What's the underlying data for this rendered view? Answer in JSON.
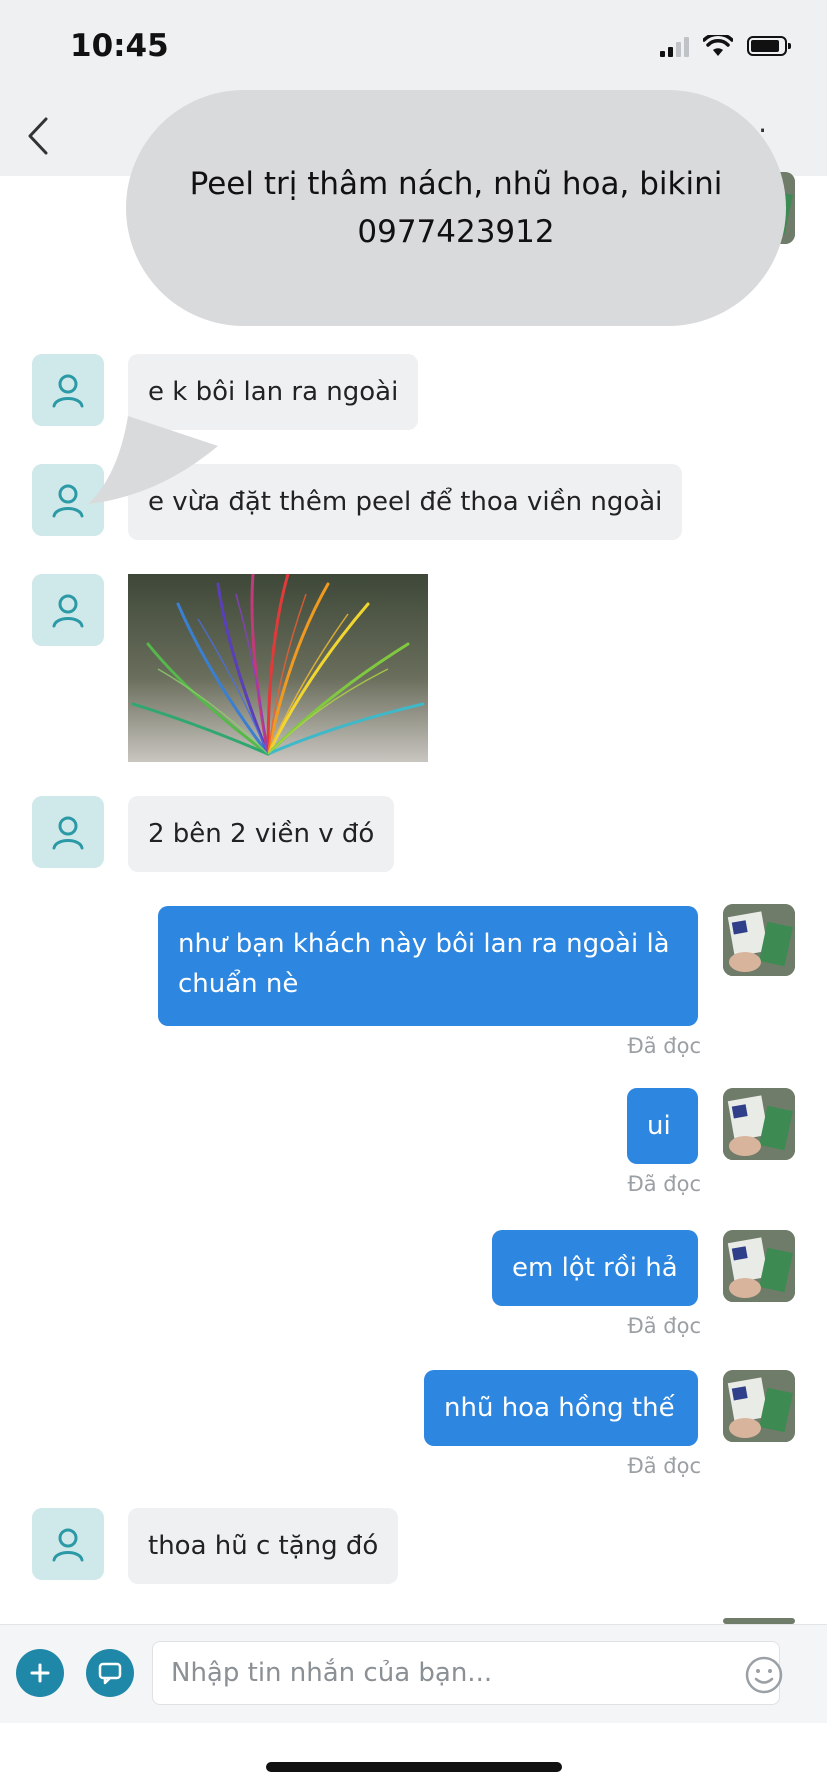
{
  "status_bar": {
    "time": "10:45"
  },
  "overlay": {
    "line1": "Peel trị thâm nách, nhũ hoa, bikini",
    "line2": "0977423912"
  },
  "messages": [
    {
      "side": "in",
      "text": "e k bôi lan ra ngoài"
    },
    {
      "side": "in",
      "text": "e vừa đặt thêm peel để thoa viền ngoài"
    },
    {
      "side": "in",
      "type": "image",
      "note": ""
    },
    {
      "side": "in",
      "text": "2 bên 2 viền v đó"
    },
    {
      "side": "out",
      "text": "như bạn khách này bôi lan ra ngoài là chuẩn nè",
      "status": "Đã đọc"
    },
    {
      "side": "out",
      "text": "ui",
      "status": "Đã đọc"
    },
    {
      "side": "out",
      "text": "em lột rồi hả",
      "status": "Đã đọc"
    },
    {
      "side": "out",
      "text": "nhũ hoa hồng thế",
      "status": "Đã đọc"
    },
    {
      "side": "in",
      "text": "thoa hũ c tặng đó"
    }
  ],
  "composer": {
    "placeholder": "Nhập tin nhắn của bạn..."
  },
  "colors": {
    "outgoing": "#2d86e0",
    "incoming": "#eef0f2",
    "accent": "#1f88a8"
  }
}
